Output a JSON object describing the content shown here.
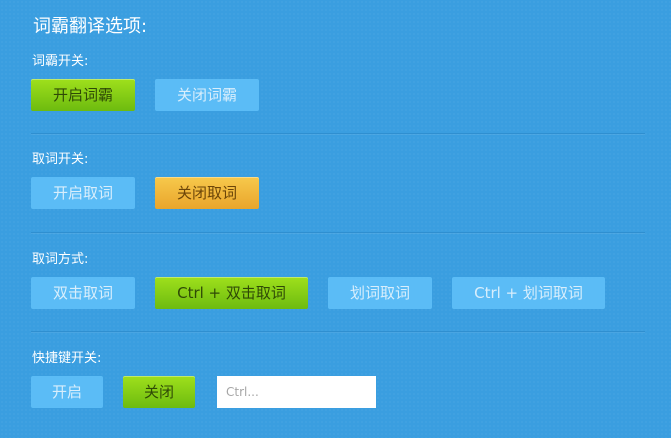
{
  "title": "词霸翻译选项:",
  "sections": {
    "toggle": {
      "label": "词霸开关:",
      "buttons": [
        "开启词霸",
        "关闭词霸"
      ]
    },
    "word_pick_toggle": {
      "label": "取词开关:",
      "buttons": [
        "开启取词",
        "关闭取词"
      ]
    },
    "word_pick_mode": {
      "label": "取词方式:",
      "buttons": [
        "双击取词",
        "Ctrl + 双击取词",
        "划词取词",
        "Ctrl + 划词取词"
      ]
    },
    "hotkey": {
      "label": "快捷键开关:",
      "buttons": [
        "开启",
        "关闭"
      ],
      "input_value": "",
      "input_placeholder": "Ctrl..."
    }
  },
  "colors": {
    "background": "#3a9ee0",
    "inactive_button": "#5bbcf6",
    "active_green": "#7fcc14",
    "active_yellow": "#f0b63a"
  }
}
